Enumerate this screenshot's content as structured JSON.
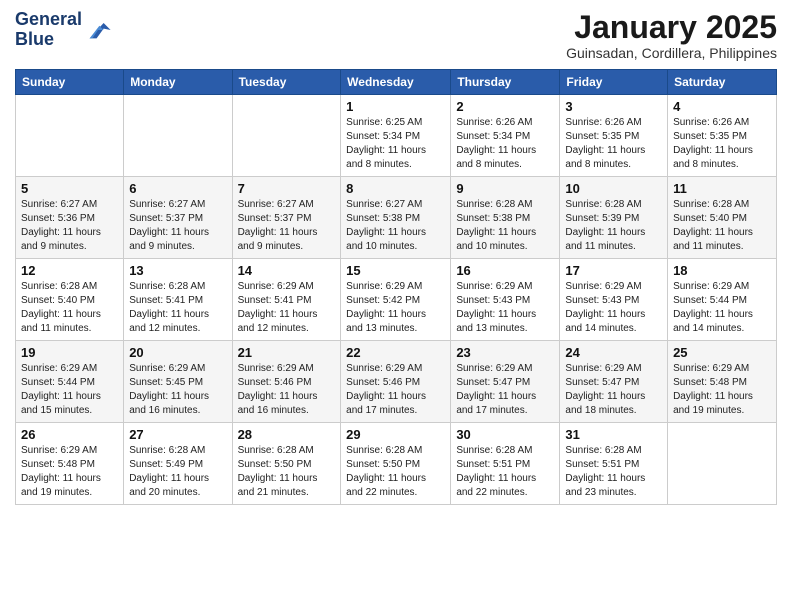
{
  "header": {
    "logo_line1": "General",
    "logo_line2": "Blue",
    "month_title": "January 2025",
    "location": "Guinsadan, Cordillera, Philippines"
  },
  "days_of_week": [
    "Sunday",
    "Monday",
    "Tuesday",
    "Wednesday",
    "Thursday",
    "Friday",
    "Saturday"
  ],
  "weeks": [
    [
      {
        "day": "",
        "sunrise": "",
        "sunset": "",
        "daylight": ""
      },
      {
        "day": "",
        "sunrise": "",
        "sunset": "",
        "daylight": ""
      },
      {
        "day": "",
        "sunrise": "",
        "sunset": "",
        "daylight": ""
      },
      {
        "day": "1",
        "sunrise": "Sunrise: 6:25 AM",
        "sunset": "Sunset: 5:34 PM",
        "daylight": "Daylight: 11 hours and 8 minutes."
      },
      {
        "day": "2",
        "sunrise": "Sunrise: 6:26 AM",
        "sunset": "Sunset: 5:34 PM",
        "daylight": "Daylight: 11 hours and 8 minutes."
      },
      {
        "day": "3",
        "sunrise": "Sunrise: 6:26 AM",
        "sunset": "Sunset: 5:35 PM",
        "daylight": "Daylight: 11 hours and 8 minutes."
      },
      {
        "day": "4",
        "sunrise": "Sunrise: 6:26 AM",
        "sunset": "Sunset: 5:35 PM",
        "daylight": "Daylight: 11 hours and 8 minutes."
      }
    ],
    [
      {
        "day": "5",
        "sunrise": "Sunrise: 6:27 AM",
        "sunset": "Sunset: 5:36 PM",
        "daylight": "Daylight: 11 hours and 9 minutes."
      },
      {
        "day": "6",
        "sunrise": "Sunrise: 6:27 AM",
        "sunset": "Sunset: 5:37 PM",
        "daylight": "Daylight: 11 hours and 9 minutes."
      },
      {
        "day": "7",
        "sunrise": "Sunrise: 6:27 AM",
        "sunset": "Sunset: 5:37 PM",
        "daylight": "Daylight: 11 hours and 9 minutes."
      },
      {
        "day": "8",
        "sunrise": "Sunrise: 6:27 AM",
        "sunset": "Sunset: 5:38 PM",
        "daylight": "Daylight: 11 hours and 10 minutes."
      },
      {
        "day": "9",
        "sunrise": "Sunrise: 6:28 AM",
        "sunset": "Sunset: 5:38 PM",
        "daylight": "Daylight: 11 hours and 10 minutes."
      },
      {
        "day": "10",
        "sunrise": "Sunrise: 6:28 AM",
        "sunset": "Sunset: 5:39 PM",
        "daylight": "Daylight: 11 hours and 11 minutes."
      },
      {
        "day": "11",
        "sunrise": "Sunrise: 6:28 AM",
        "sunset": "Sunset: 5:40 PM",
        "daylight": "Daylight: 11 hours and 11 minutes."
      }
    ],
    [
      {
        "day": "12",
        "sunrise": "Sunrise: 6:28 AM",
        "sunset": "Sunset: 5:40 PM",
        "daylight": "Daylight: 11 hours and 11 minutes."
      },
      {
        "day": "13",
        "sunrise": "Sunrise: 6:28 AM",
        "sunset": "Sunset: 5:41 PM",
        "daylight": "Daylight: 11 hours and 12 minutes."
      },
      {
        "day": "14",
        "sunrise": "Sunrise: 6:29 AM",
        "sunset": "Sunset: 5:41 PM",
        "daylight": "Daylight: 11 hours and 12 minutes."
      },
      {
        "day": "15",
        "sunrise": "Sunrise: 6:29 AM",
        "sunset": "Sunset: 5:42 PM",
        "daylight": "Daylight: 11 hours and 13 minutes."
      },
      {
        "day": "16",
        "sunrise": "Sunrise: 6:29 AM",
        "sunset": "Sunset: 5:43 PM",
        "daylight": "Daylight: 11 hours and 13 minutes."
      },
      {
        "day": "17",
        "sunrise": "Sunrise: 6:29 AM",
        "sunset": "Sunset: 5:43 PM",
        "daylight": "Daylight: 11 hours and 14 minutes."
      },
      {
        "day": "18",
        "sunrise": "Sunrise: 6:29 AM",
        "sunset": "Sunset: 5:44 PM",
        "daylight": "Daylight: 11 hours and 14 minutes."
      }
    ],
    [
      {
        "day": "19",
        "sunrise": "Sunrise: 6:29 AM",
        "sunset": "Sunset: 5:44 PM",
        "daylight": "Daylight: 11 hours and 15 minutes."
      },
      {
        "day": "20",
        "sunrise": "Sunrise: 6:29 AM",
        "sunset": "Sunset: 5:45 PM",
        "daylight": "Daylight: 11 hours and 16 minutes."
      },
      {
        "day": "21",
        "sunrise": "Sunrise: 6:29 AM",
        "sunset": "Sunset: 5:46 PM",
        "daylight": "Daylight: 11 hours and 16 minutes."
      },
      {
        "day": "22",
        "sunrise": "Sunrise: 6:29 AM",
        "sunset": "Sunset: 5:46 PM",
        "daylight": "Daylight: 11 hours and 17 minutes."
      },
      {
        "day": "23",
        "sunrise": "Sunrise: 6:29 AM",
        "sunset": "Sunset: 5:47 PM",
        "daylight": "Daylight: 11 hours and 17 minutes."
      },
      {
        "day": "24",
        "sunrise": "Sunrise: 6:29 AM",
        "sunset": "Sunset: 5:47 PM",
        "daylight": "Daylight: 11 hours and 18 minutes."
      },
      {
        "day": "25",
        "sunrise": "Sunrise: 6:29 AM",
        "sunset": "Sunset: 5:48 PM",
        "daylight": "Daylight: 11 hours and 19 minutes."
      }
    ],
    [
      {
        "day": "26",
        "sunrise": "Sunrise: 6:29 AM",
        "sunset": "Sunset: 5:48 PM",
        "daylight": "Daylight: 11 hours and 19 minutes."
      },
      {
        "day": "27",
        "sunrise": "Sunrise: 6:28 AM",
        "sunset": "Sunset: 5:49 PM",
        "daylight": "Daylight: 11 hours and 20 minutes."
      },
      {
        "day": "28",
        "sunrise": "Sunrise: 6:28 AM",
        "sunset": "Sunset: 5:50 PM",
        "daylight": "Daylight: 11 hours and 21 minutes."
      },
      {
        "day": "29",
        "sunrise": "Sunrise: 6:28 AM",
        "sunset": "Sunset: 5:50 PM",
        "daylight": "Daylight: 11 hours and 22 minutes."
      },
      {
        "day": "30",
        "sunrise": "Sunrise: 6:28 AM",
        "sunset": "Sunset: 5:51 PM",
        "daylight": "Daylight: 11 hours and 22 minutes."
      },
      {
        "day": "31",
        "sunrise": "Sunrise: 6:28 AM",
        "sunset": "Sunset: 5:51 PM",
        "daylight": "Daylight: 11 hours and 23 minutes."
      },
      {
        "day": "",
        "sunrise": "",
        "sunset": "",
        "daylight": ""
      }
    ]
  ]
}
